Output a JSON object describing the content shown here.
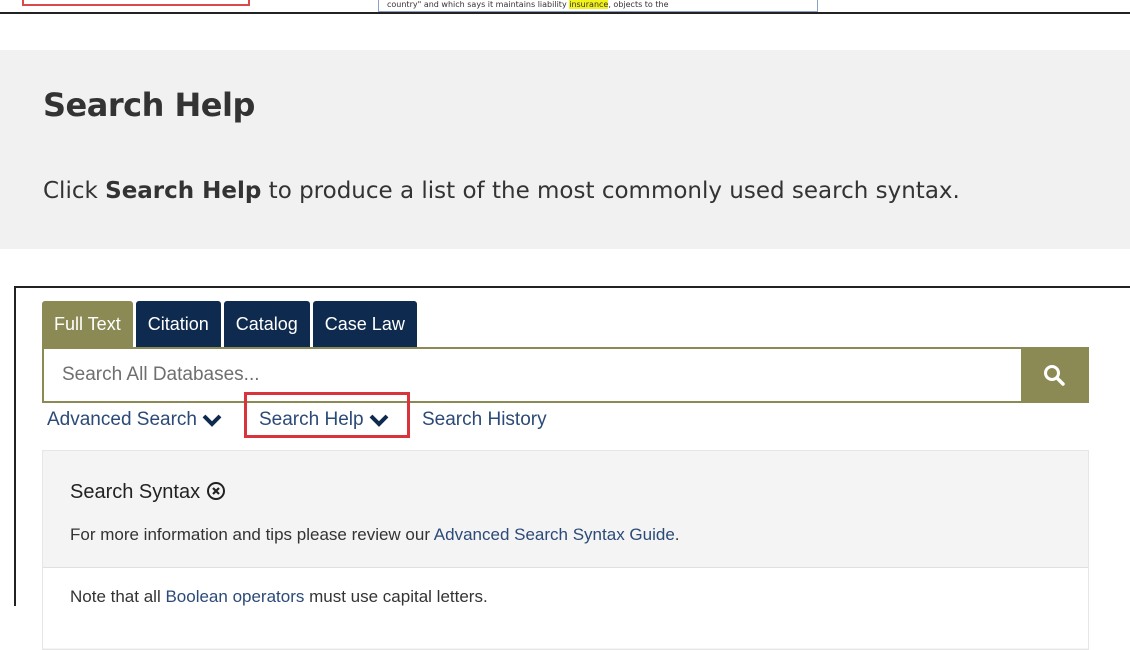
{
  "top_fragment": {
    "text_before": "country\" and which says it maintains liability ",
    "highlight": "insurance",
    "text_after": ", objects to the"
  },
  "help_card": {
    "title": "Search Help",
    "desc_before": "Click ",
    "desc_bold": "Search Help",
    "desc_after": " to produce a list of the most commonly used search syntax."
  },
  "tabs": [
    {
      "label": "Full Text",
      "active": true
    },
    {
      "label": "Citation",
      "active": false
    },
    {
      "label": "Catalog",
      "active": false
    },
    {
      "label": "Case Law",
      "active": false
    }
  ],
  "search": {
    "placeholder": "Search All Databases..."
  },
  "links": {
    "advanced": "Advanced Search",
    "help": "Search Help",
    "history": "Search History"
  },
  "syntax_panel": {
    "title": "Search Syntax",
    "info_before": "For more information and tips please review our ",
    "info_link": "Advanced Search Syntax Guide",
    "info_after": ".",
    "note_before": "Note that all ",
    "note_link": "Boolean operators",
    "note_after": " must use capital letters."
  },
  "colors": {
    "olive": "#8b8a55",
    "navy": "#0e2a4e",
    "link": "#2b4a78",
    "highlight_border": "#d9343b"
  }
}
